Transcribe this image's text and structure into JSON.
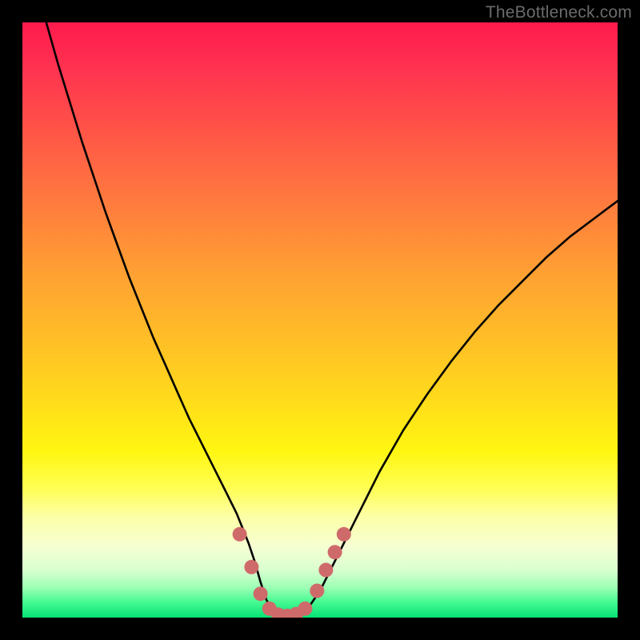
{
  "watermark": "TheBottleneck.com",
  "colors": {
    "frame": "#000000",
    "curve_stroke": "#000000",
    "marker_fill": "#cf6a6a",
    "marker_stroke": "#b85a5a"
  },
  "chart_data": {
    "type": "line",
    "title": "",
    "xlabel": "",
    "ylabel": "",
    "xlim": [
      0,
      100
    ],
    "ylim": [
      0,
      100
    ],
    "x": [
      4,
      6,
      8,
      10,
      12,
      14,
      16,
      18,
      20,
      22,
      24,
      26,
      28,
      30,
      32,
      34,
      36,
      37,
      38,
      39,
      40,
      41,
      42,
      43,
      44,
      45,
      46,
      47,
      48,
      50,
      52,
      54,
      56,
      58,
      60,
      64,
      68,
      72,
      76,
      80,
      84,
      88,
      92,
      96,
      100
    ],
    "values": [
      100,
      93,
      86.5,
      80,
      74,
      68,
      62.5,
      57,
      52,
      47,
      42.5,
      38,
      33.5,
      29.5,
      25.5,
      21.5,
      17.5,
      15,
      12.5,
      9.5,
      6,
      3,
      1.2,
      0.4,
      0.2,
      0.2,
      0.3,
      0.8,
      1.6,
      4.5,
      8.5,
      12.5,
      16.5,
      20.5,
      24.5,
      31.5,
      37.5,
      43,
      48,
      52.5,
      56.5,
      60.5,
      64,
      67,
      70
    ],
    "markers": {
      "x": [
        36.5,
        38.5,
        40,
        41.5,
        43,
        44.5,
        46,
        47.5,
        49.5,
        51,
        52.5,
        54
      ],
      "y": [
        14,
        8.5,
        4,
        1.5,
        0.5,
        0.3,
        0.6,
        1.5,
        4.5,
        8,
        11,
        14
      ]
    },
    "note": "Values are approximate % read from an unlabeled bottleneck-style curve. Minimum ~x=44. No axis ticks or numeric labels visible."
  }
}
